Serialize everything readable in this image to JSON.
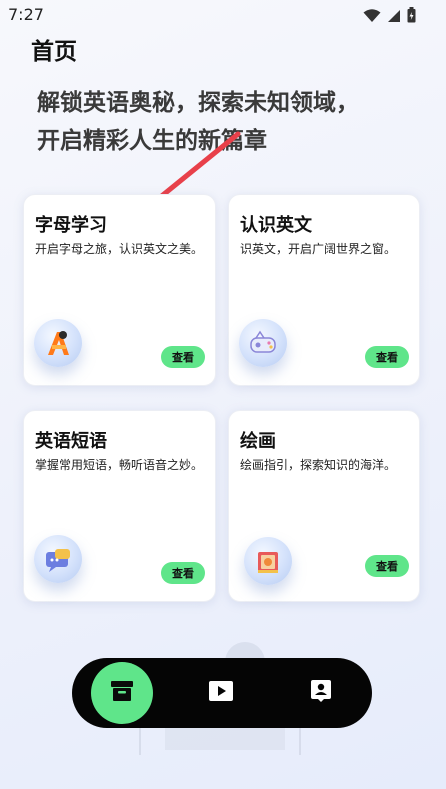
{
  "status_bar": {
    "time": "7:27",
    "icons": [
      "wifi-icon",
      "signal-icon",
      "battery-icon"
    ]
  },
  "page": {
    "title": "首页",
    "hero_line1": "解锁英语奥秘，探索未知领域，",
    "hero_line2": "开启精彩人生的新篇章"
  },
  "cards": [
    {
      "title": "字母学习",
      "desc": "开启字母之旅，认识英文之美。",
      "button": "查看",
      "icon": "letter-a-icon"
    },
    {
      "title": "认识英文",
      "desc": "识英文，开启广阔世界之窗。",
      "button": "查看",
      "icon": "game-controller-icon"
    },
    {
      "title": "英语短语",
      "desc": "掌握常用短语，畅听语音之妙。",
      "button": "查看",
      "icon": "speech-bubble-icon"
    },
    {
      "title": "绘画",
      "desc": "绘画指引，探索知识的海洋。",
      "button": "查看",
      "icon": "paint-book-icon"
    }
  ],
  "bottom_nav": {
    "items": [
      "archive-icon",
      "video-play-icon",
      "profile-card-icon"
    ],
    "active": "archive-icon"
  },
  "colors": {
    "accent": "#5fe58a",
    "nav_background": "#050505",
    "arrow": "#e8404a"
  }
}
